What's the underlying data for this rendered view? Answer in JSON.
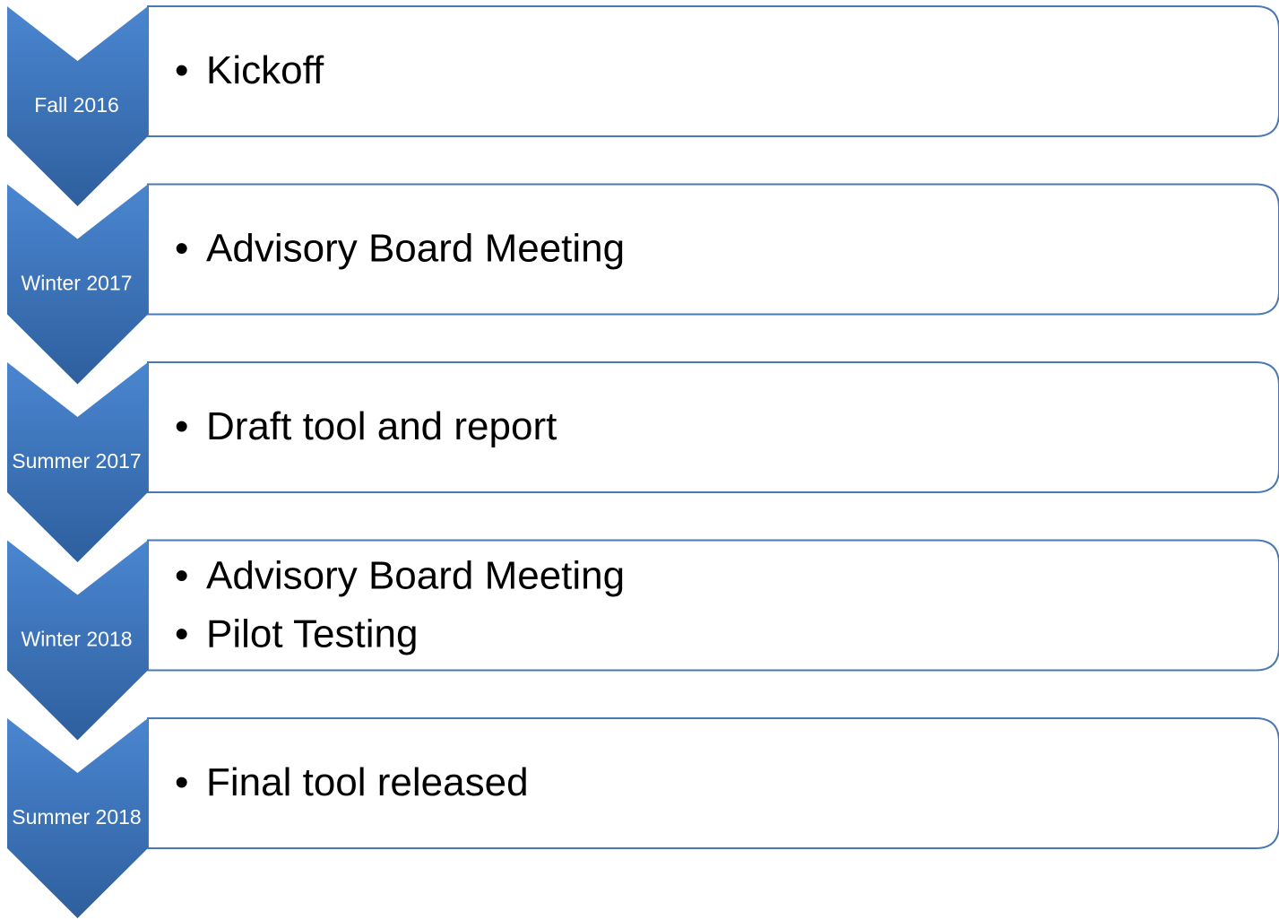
{
  "colors": {
    "chevron_light": "#4a86d0",
    "chevron_dark": "#2e5f9e",
    "box_border": "#4a78b5",
    "box_fill": "#ffffff",
    "text": "#000000",
    "label_text": "#ffffff"
  },
  "bullet_glyph": "•",
  "steps": [
    {
      "label": "Fall 2016",
      "items": [
        "Kickoff"
      ]
    },
    {
      "label": "Winter 2017",
      "items": [
        "Advisory Board Meeting"
      ]
    },
    {
      "label": "Summer 2017",
      "items": [
        "Draft tool and report"
      ]
    },
    {
      "label": "Winter 2018",
      "items": [
        "Advisory Board Meeting",
        "Pilot Testing"
      ]
    },
    {
      "label": "Summer 2018",
      "items": [
        "Final tool released"
      ]
    }
  ]
}
